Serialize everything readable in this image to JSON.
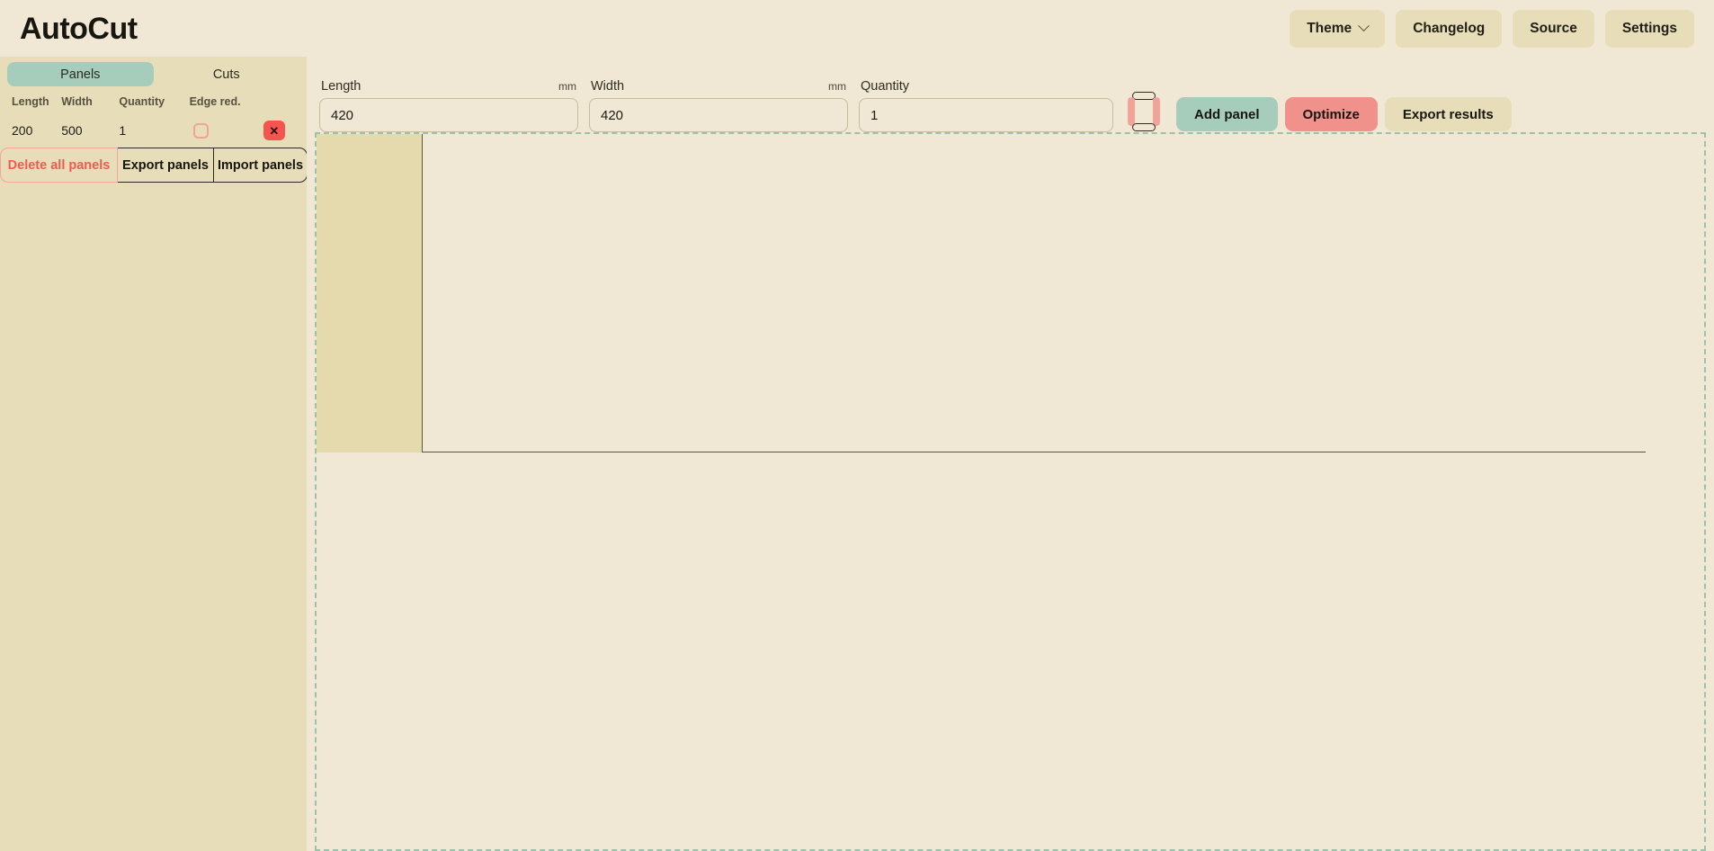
{
  "header": {
    "brand": "AutoCut",
    "nav": [
      {
        "label": "Theme",
        "icon": "chevron-down-icon",
        "has_chevron": true
      },
      {
        "label": "Changelog",
        "has_chevron": false
      },
      {
        "label": "Source",
        "has_chevron": false
      },
      {
        "label": "Settings",
        "has_chevron": false
      }
    ]
  },
  "sidebar": {
    "tabs": [
      {
        "label": "Panels",
        "active": true
      },
      {
        "label": "Cuts",
        "active": false
      }
    ],
    "table": {
      "columns": [
        "Length",
        "Width",
        "Quantity",
        "Edge red.",
        ""
      ],
      "rows": [
        {
          "length": "200",
          "width": "500",
          "quantity": "1",
          "edge_reduction_checked": false,
          "delete_label": "✕"
        }
      ]
    },
    "actions": [
      {
        "label": "Delete all panels",
        "style": "danger"
      },
      {
        "label": "Export panels",
        "style": "normal"
      },
      {
        "label": "Import panels",
        "style": "normal"
      }
    ]
  },
  "main": {
    "form": {
      "length": {
        "label": "Length",
        "unit": "mm",
        "value": "420",
        "placeholder": "Length"
      },
      "width": {
        "label": "Width",
        "unit": "mm",
        "value": "420",
        "placeholder": "Width"
      },
      "quantity": {
        "label": "Quantity",
        "value": "1",
        "placeholder": "Quantity"
      },
      "edge_band_icon": "edge-banding-icon",
      "buttons": [
        {
          "label": "Add panel",
          "style": "add"
        },
        {
          "label": "Optimize",
          "style": "optimize"
        },
        {
          "label": "Export results",
          "style": "export"
        }
      ]
    },
    "canvas": {
      "sheets": [
        {
          "panels": [
            {
              "label": ""
            }
          ]
        }
      ]
    }
  },
  "colors": {
    "background": "#f0e7d4",
    "sidebar": "#e7ddb9",
    "accent_green": "#a6cdbb",
    "accent_pink": "#f0918c",
    "danger_red": "#f4554e",
    "panel_fill": "#e4daad",
    "cut_line": "#5d5536",
    "dashed_border": "#9bc3ab",
    "text": "#17160f"
  }
}
